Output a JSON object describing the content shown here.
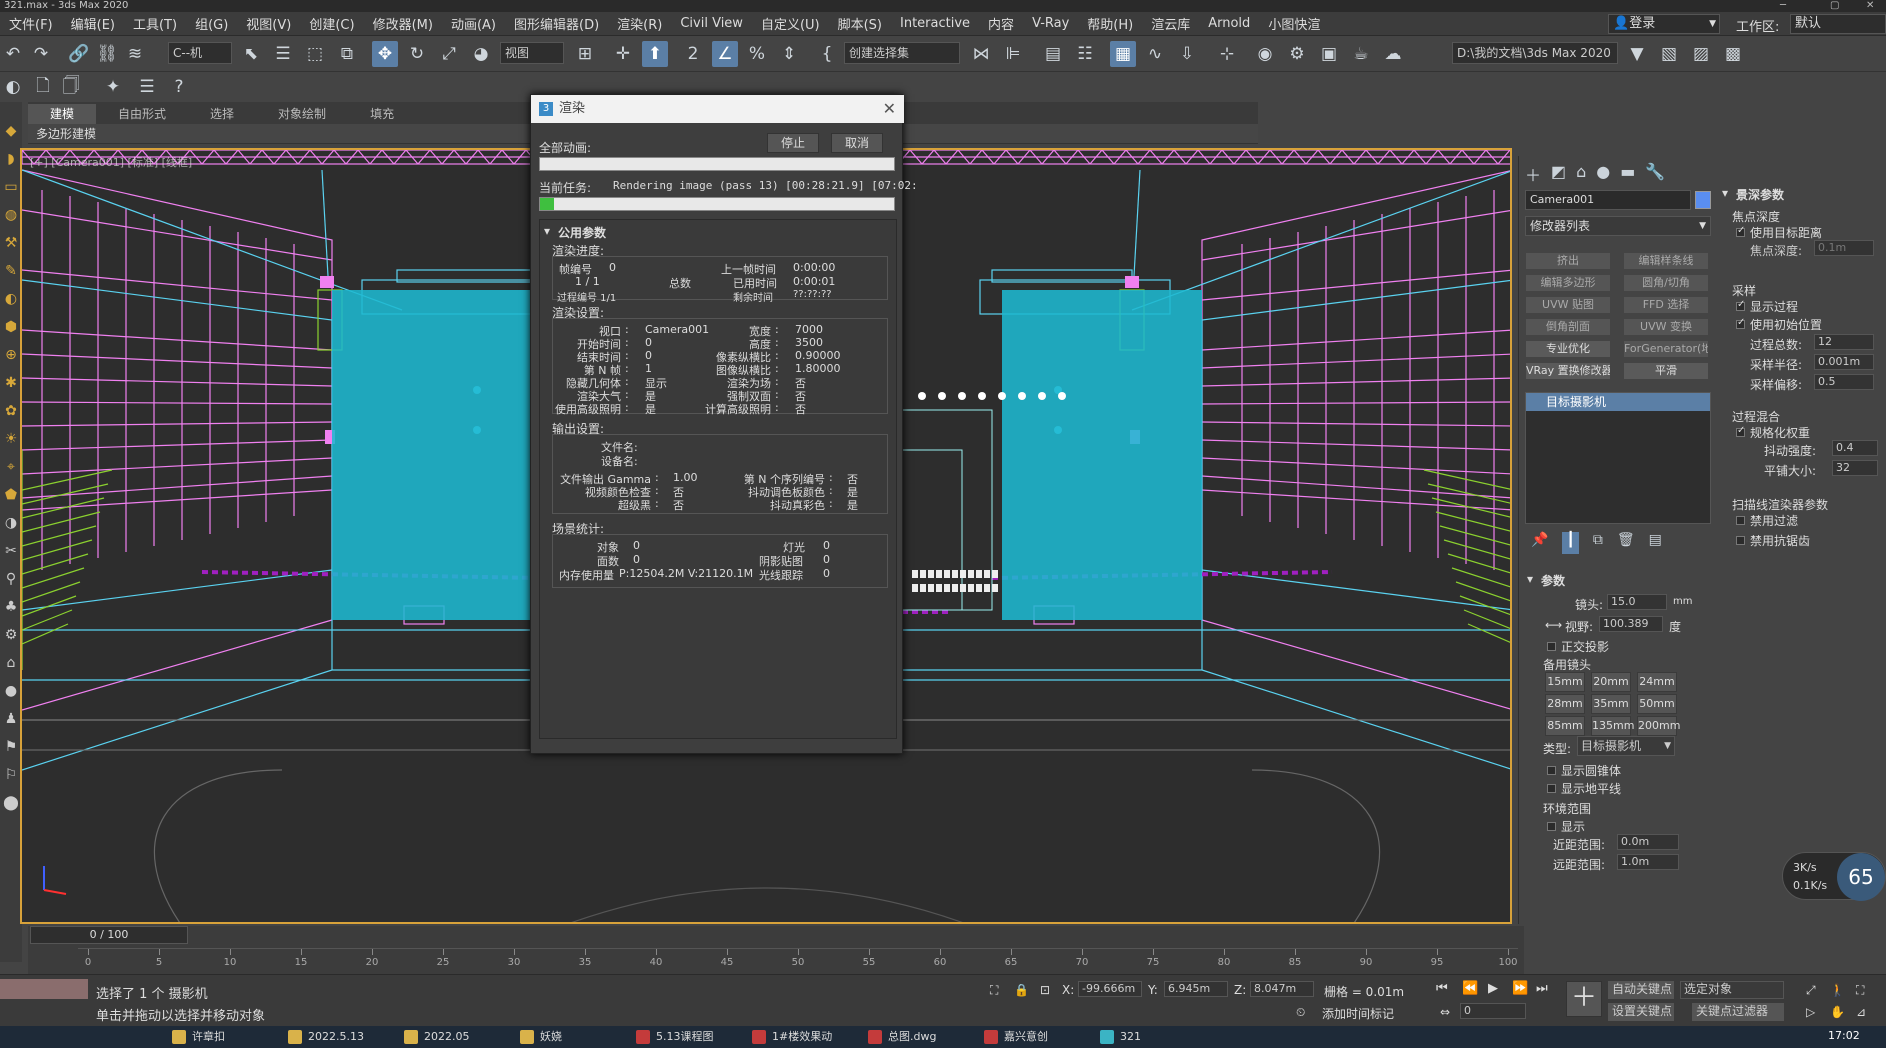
{
  "window": {
    "title": "321.max - 3ds Max 2020"
  },
  "menu": [
    "文件(F)",
    "编辑(E)",
    "工具(T)",
    "组(G)",
    "视图(V)",
    "创建(C)",
    "修改器(M)",
    "动画(A)",
    "图形编辑器(D)",
    "渲染(R)",
    "Civil View",
    "自定义(U)",
    "脚本(S)",
    "Interactive",
    "内容",
    "V-Ray",
    "帮助(H)",
    "渲云库",
    "Arnold",
    "小图快渲"
  ],
  "account": {
    "login": "登录",
    "workspace_label": "工作区:",
    "workspace_value": "默认"
  },
  "toolbar": {
    "selection_filter": "C--机",
    "ref_coord": "视图",
    "named_selection": "创建选择集",
    "project_path": "D:\\我的文档\\3ds Max 2020"
  },
  "ribbon": {
    "tabs": [
      "建模",
      "自由形式",
      "选择",
      "对象绘制",
      "填充"
    ],
    "sub": "多边形建模"
  },
  "viewport": {
    "label": "[+] [Camera001] [标准] [线框]"
  },
  "render_dialog": {
    "title": "渲染",
    "all_anim_label": "全部动画:",
    "stop": "停止",
    "cancel": "取消",
    "current_task_label": "当前任务:",
    "current_task": "Rendering image (pass 13) [00:28:21.9] [07:02:",
    "total_progress": 0,
    "task_progress": 0.04,
    "section_title": "公用参数",
    "progress": {
      "title": "渲染进度:",
      "frame_label": "帧编号",
      "frame": "0",
      "last_frame_label": "上一帧时间",
      "last_frame": "0:00:00",
      "count": "1 / 1",
      "total_label": "总数",
      "elapsed_label": "已用时间",
      "elapsed": "0:00:01",
      "pass_label": "过程编号 1/1",
      "remaining_label": "剩余时间",
      "remaining": "??:??:??"
    },
    "render_settings": {
      "title": "渲染设置:",
      "rows": [
        [
          "视口",
          "Camera001",
          "宽度",
          "7000"
        ],
        [
          "开始时间",
          "0",
          "高度",
          "3500"
        ],
        [
          "结束时间",
          "0",
          "像素纵横比",
          "0.90000"
        ],
        [
          "第 N 帧",
          "1",
          "图像纵横比",
          "1.80000"
        ],
        [
          "隐藏几何体",
          "显示",
          "渲染为场",
          "否"
        ],
        [
          "渲染大气",
          "是",
          "强制双面",
          "否"
        ],
        [
          "使用高级照明",
          "是",
          "计算高级照明",
          "否"
        ]
      ]
    },
    "output": {
      "title": "输出设置:",
      "file_label": "文件名:",
      "device_label": "设备名:",
      "rows": [
        [
          "文件输出 Gamma",
          "1.00",
          "第 N 个序列编号",
          "否"
        ],
        [
          "视频颜色检查",
          "否",
          "抖动调色板颜色",
          "是"
        ],
        [
          "超级黑",
          "否",
          "抖动真彩色",
          "是"
        ]
      ]
    },
    "stats": {
      "title": "场景统计:",
      "objects_label": "对象",
      "objects": "0",
      "lights_label": "灯光",
      "lights": "0",
      "faces_label": "面数",
      "faces": "0",
      "shadow_label": "阴影贴图",
      "shadow": "0",
      "memory_label": "内存使用量",
      "memory": "P:12504.2M V:21120.1M",
      "raytrace_label": "光线跟踪",
      "raytrace": "0"
    }
  },
  "command_panel": {
    "object_name": "Camera001",
    "modifier_list": "修改器列表",
    "mod_buttons": [
      {
        "label": "挤出",
        "enabled": false
      },
      {
        "label": "编辑样条线",
        "enabled": false
      },
      {
        "label": "编辑多边形",
        "enabled": false
      },
      {
        "label": "圆角/切角",
        "enabled": false
      },
      {
        "label": "UVW 贴图",
        "enabled": false
      },
      {
        "label": "FFD 选择",
        "enabled": false
      },
      {
        "label": "倒角剖面",
        "enabled": false
      },
      {
        "label": "UVW 变换",
        "enabled": false
      },
      {
        "label": "专业优化",
        "enabled": true
      },
      {
        "label": "ForGenerator(地",
        "enabled": false
      },
      {
        "label": "VRay 置换修改器",
        "enabled": true
      },
      {
        "label": "平滑",
        "enabled": true
      }
    ],
    "stack_item": "目标摄影机",
    "params": {
      "title": "参数",
      "lens_label": "镜头:",
      "lens": "15.0",
      "lens_unit": "mm",
      "fov_label": "视野:",
      "fov": "100.389",
      "fov_unit": "度",
      "ortho": "正交投影",
      "stock_label": "备用镜头",
      "stock": [
        "15mm",
        "20mm",
        "24mm",
        "28mm",
        "35mm",
        "50mm",
        "85mm",
        "135mm",
        "200mm"
      ],
      "type_label": "类型:",
      "type": "目标摄影机",
      "show_cone": "显示圆锥体",
      "show_horizon": "显示地平线",
      "env_label": "环境范围",
      "env_show": "显示",
      "near_label": "近距范围:",
      "near": "0.0m",
      "far_label": "远距范围:",
      "far": "1.0m"
    }
  },
  "dof_panel": {
    "title": "景深参数",
    "focal_label": "焦点深度",
    "use_target": "使用目标距离",
    "focal_depth_label": "焦点深度:",
    "focal_depth": "0.1m",
    "sample_label": "采样",
    "show_pass": "显示过程",
    "use_orig": "使用初始位置",
    "total_pass_label": "过程总数:",
    "total_pass": "12",
    "radius_label": "采样半径:",
    "radius": "0.001m",
    "bias_label": "采样偏移:",
    "bias": "0.5",
    "mix_label": "过程混合",
    "norm": "规格化权重",
    "dither_label": "抖动强度:",
    "dither": "0.4",
    "tile_label": "平铺大小:",
    "tile": "32",
    "scan_label": "扫描线渲染器参数",
    "dis_filter": "禁用过滤",
    "dis_aa": "禁用抗锯齿"
  },
  "timeline": {
    "frame": "0 / 100",
    "ticks": [
      0,
      5,
      10,
      15,
      20,
      25,
      30,
      35,
      40,
      45,
      50,
      55,
      60,
      65,
      70,
      75,
      80,
      85,
      90,
      95,
      100
    ]
  },
  "status": {
    "selection": "选择了 1 个 摄影机",
    "hint": "单击并拖动以选择并移动对象",
    "x": "-99.666m",
    "y": "6.945m",
    "z": "8.047m",
    "grid": "栅格 = 0.01m",
    "add_time_tag": "添加时间标记",
    "auto_key": "自动关键点",
    "set_key": "设置关键点",
    "selected_obj": "选定对象",
    "key_filter": "关键点过滤器",
    "frame": "0"
  },
  "network": {
    "up": "3K/s",
    "down": "0.1K/s",
    "percent": "65"
  },
  "taskbar": {
    "items": [
      "许章扣",
      "2022.5.13",
      "2022.05",
      "妖娆",
      "5.13课程图",
      "1#楼效果动",
      "总图.dwg",
      "嘉兴意创",
      "321"
    ],
    "clock": "17:02"
  }
}
